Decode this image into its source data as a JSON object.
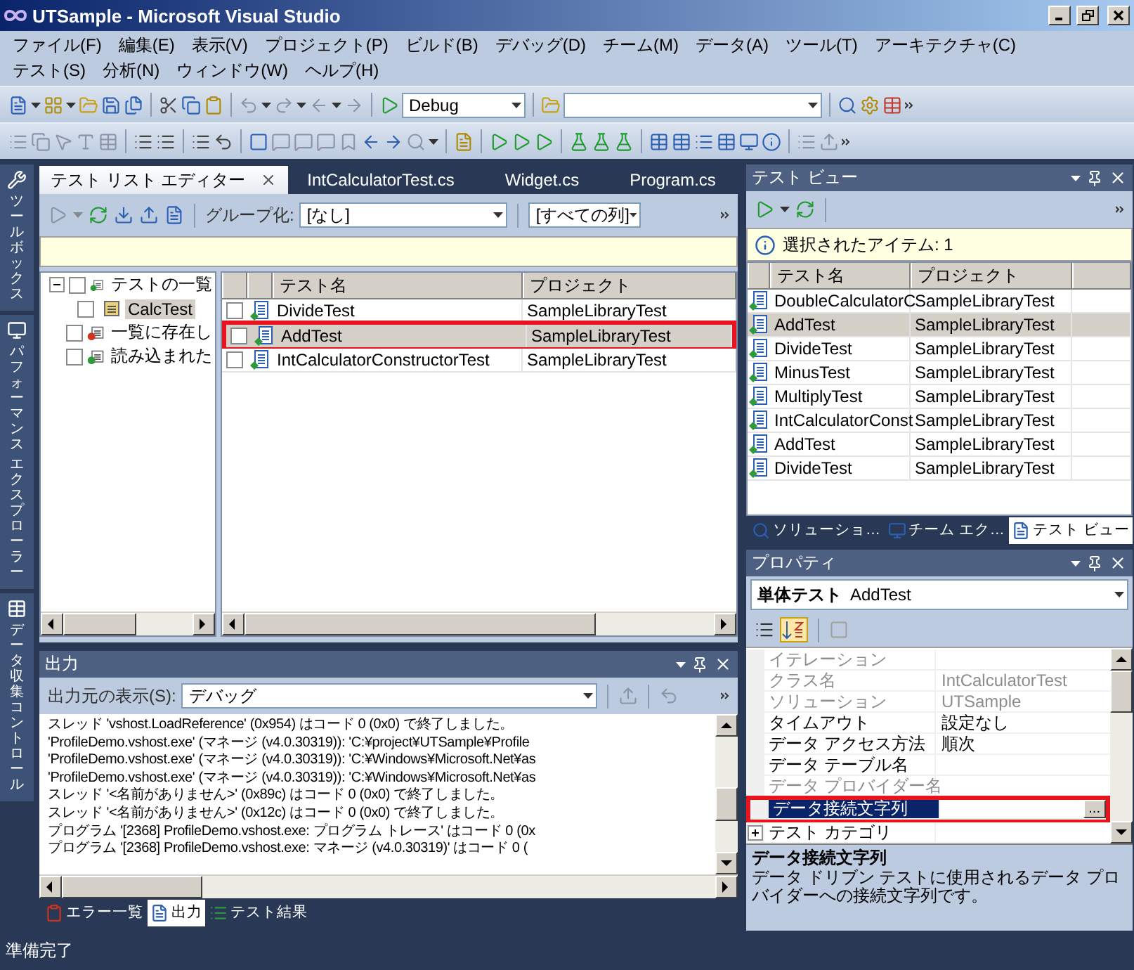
{
  "window": {
    "title": "UTSample - Microsoft Visual Studio"
  },
  "menu": [
    {
      "label": "ファイル(F)"
    },
    {
      "label": "編集(E)"
    },
    {
      "label": "表示(V)"
    },
    {
      "label": "プロジェクト(P)"
    },
    {
      "label": "ビルド(B)"
    },
    {
      "label": "デバッグ(D)"
    },
    {
      "label": "チーム(M)"
    },
    {
      "label": "データ(A)"
    },
    {
      "label": "ツール(T)"
    },
    {
      "label": "アーキテクチャ(C)"
    },
    {
      "label": "テスト(S)"
    },
    {
      "label": "分析(N)"
    },
    {
      "label": "ウィンドウ(W)"
    },
    {
      "label": "ヘルプ(H)"
    }
  ],
  "toolbar": {
    "configuration": "Debug"
  },
  "side_tabs": [
    {
      "lines": [
        "ツールボックス"
      ],
      "kind": "toolbox"
    },
    {
      "lines": [
        "パフォーマンス",
        "エクスプローラー"
      ],
      "kind": "performance"
    },
    {
      "lines": [
        "データ収集コントロール"
      ],
      "kind": "data"
    }
  ],
  "document_tabs": [
    {
      "label": "テスト リスト エディター",
      "selected": true
    },
    {
      "label": "IntCalculatorTest.cs",
      "selected": false
    },
    {
      "label": "Widget.cs",
      "selected": false
    },
    {
      "label": "Program.cs",
      "selected": false
    }
  ],
  "test_list": {
    "group_by_label": "グループ化:",
    "group_by": "[なし]",
    "columns_filter": "[すべての列]",
    "tree": [
      {
        "label": "テストの一覧",
        "kind": "all",
        "checked": false,
        "selected": false,
        "expanded": true,
        "children": [
          {
            "label": "CalcTest",
            "kind": "list",
            "checked": false,
            "selected": true
          }
        ]
      },
      {
        "label": "一覧に存在し",
        "kind": "missing",
        "checked": false,
        "selected": false
      },
      {
        "label": "読み込まれた",
        "kind": "loaded",
        "checked": false,
        "selected": false
      }
    ],
    "columns": [
      "テスト名",
      "プロジェクト"
    ],
    "rows": [
      {
        "name": "DivideTest",
        "project": "SampleLibraryTest",
        "checked": false,
        "selected": false,
        "highlighted": false
      },
      {
        "name": "AddTest",
        "project": "SampleLibraryTest",
        "checked": false,
        "selected": true,
        "highlighted": true
      },
      {
        "name": "IntCalculatorConstructorTest",
        "project": "SampleLibraryTest",
        "checked": false,
        "selected": false,
        "highlighted": false
      }
    ]
  },
  "output": {
    "title": "出力",
    "source_label": "出力元の表示(S):",
    "source": "デバッグ",
    "lines": [
      "スレッド 'vshost.LoadReference' (0x954) はコード 0 (0x0) で終了しました。",
      "'ProfileDemo.vshost.exe' (マネージ (v4.0.30319)): 'C:¥project¥UTSample¥Profile",
      "'ProfileDemo.vshost.exe' (マネージ (v4.0.30319)): 'C:¥Windows¥Microsoft.Net¥as",
      "'ProfileDemo.vshost.exe' (マネージ (v4.0.30319)): 'C:¥Windows¥Microsoft.Net¥as",
      "スレッド '<名前がありません>' (0x89c) はコード 0 (0x0) で終了しました。",
      "スレッド '<名前がありません>' (0x12c) はコード 0 (0x0) で終了しました。",
      "プログラム '[2368] ProfileDemo.vshost.exe: プログラム トレース' はコード 0 (0x",
      "プログラム '[2368] ProfileDemo.vshost.exe: マネージ (v4.0.30319)' はコード 0 ("
    ]
  },
  "bottom_tabs": [
    {
      "label": "エラー一覧",
      "kind": "errors",
      "selected": false
    },
    {
      "label": "出力",
      "kind": "output",
      "selected": true
    },
    {
      "label": "テスト結果",
      "kind": "results",
      "selected": false
    }
  ],
  "test_view": {
    "title": "テスト ビュー",
    "info": "選択されたアイテム: 1",
    "columns": [
      "テスト名",
      "プロジェクト"
    ],
    "rows": [
      {
        "name": "DoubleCalculatorC",
        "project": "SampleLibraryTest",
        "selected": false
      },
      {
        "name": "AddTest",
        "project": "SampleLibraryTest",
        "selected": true
      },
      {
        "name": "DivideTest",
        "project": "SampleLibraryTest",
        "selected": false
      },
      {
        "name": "MinusTest",
        "project": "SampleLibraryTest",
        "selected": false
      },
      {
        "name": "MultiplyTest",
        "project": "SampleLibraryTest",
        "selected": false
      },
      {
        "name": "IntCalculatorConst",
        "project": "SampleLibraryTest",
        "selected": false
      },
      {
        "name": "AddTest",
        "project": "SampleLibraryTest",
        "selected": false
      },
      {
        "name": "DivideTest",
        "project": "SampleLibraryTest",
        "selected": false
      }
    ],
    "tabs": [
      {
        "label": "ソリューショ…",
        "kind": "solution",
        "selected": false
      },
      {
        "label": "チーム エク…",
        "kind": "team",
        "selected": false
      },
      {
        "label": "テスト ビュー",
        "kind": "test",
        "selected": true
      }
    ]
  },
  "properties": {
    "title": "プロパティ",
    "object_type": "単体テスト",
    "object_name": "AddTest",
    "rows": [
      {
        "name": "イテレーション",
        "kind": "property",
        "disabled": true,
        "selected": false,
        "highlighted": false
      },
      {
        "name": "クラス名",
        "value": "IntCalculatorTest",
        "kind": "property",
        "disabled": true,
        "selected": false,
        "highlighted": false
      },
      {
        "name": "ソリューション",
        "value": "UTSample",
        "kind": "property",
        "disabled": true,
        "selected": false,
        "highlighted": false
      },
      {
        "name": "タイムアウト",
        "value": "設定なし",
        "kind": "property",
        "disabled": false,
        "selected": false,
        "highlighted": false
      },
      {
        "name": "データ アクセス方法",
        "value": "順次",
        "kind": "property",
        "disabled": false,
        "selected": false,
        "highlighted": false
      },
      {
        "name": "データ テーブル名",
        "kind": "property",
        "disabled": false,
        "selected": false,
        "highlighted": false
      },
      {
        "name": "データ プロバイダー名",
        "kind": "property",
        "disabled": true,
        "selected": false,
        "highlighted": false
      },
      {
        "name": "データ接続文字列",
        "button": "...",
        "kind": "property",
        "disabled": false,
        "selected": true,
        "highlighted": true
      },
      {
        "name": "テスト カテゴリ",
        "kind": "group",
        "disabled": false,
        "selected": false,
        "highlighted": false
      }
    ],
    "description": {
      "title": "データ接続文字列",
      "text": "データ ドリブン テストに使用されるデータ プロバイダーへの接続文字列です。"
    }
  },
  "status": "準備完了"
}
